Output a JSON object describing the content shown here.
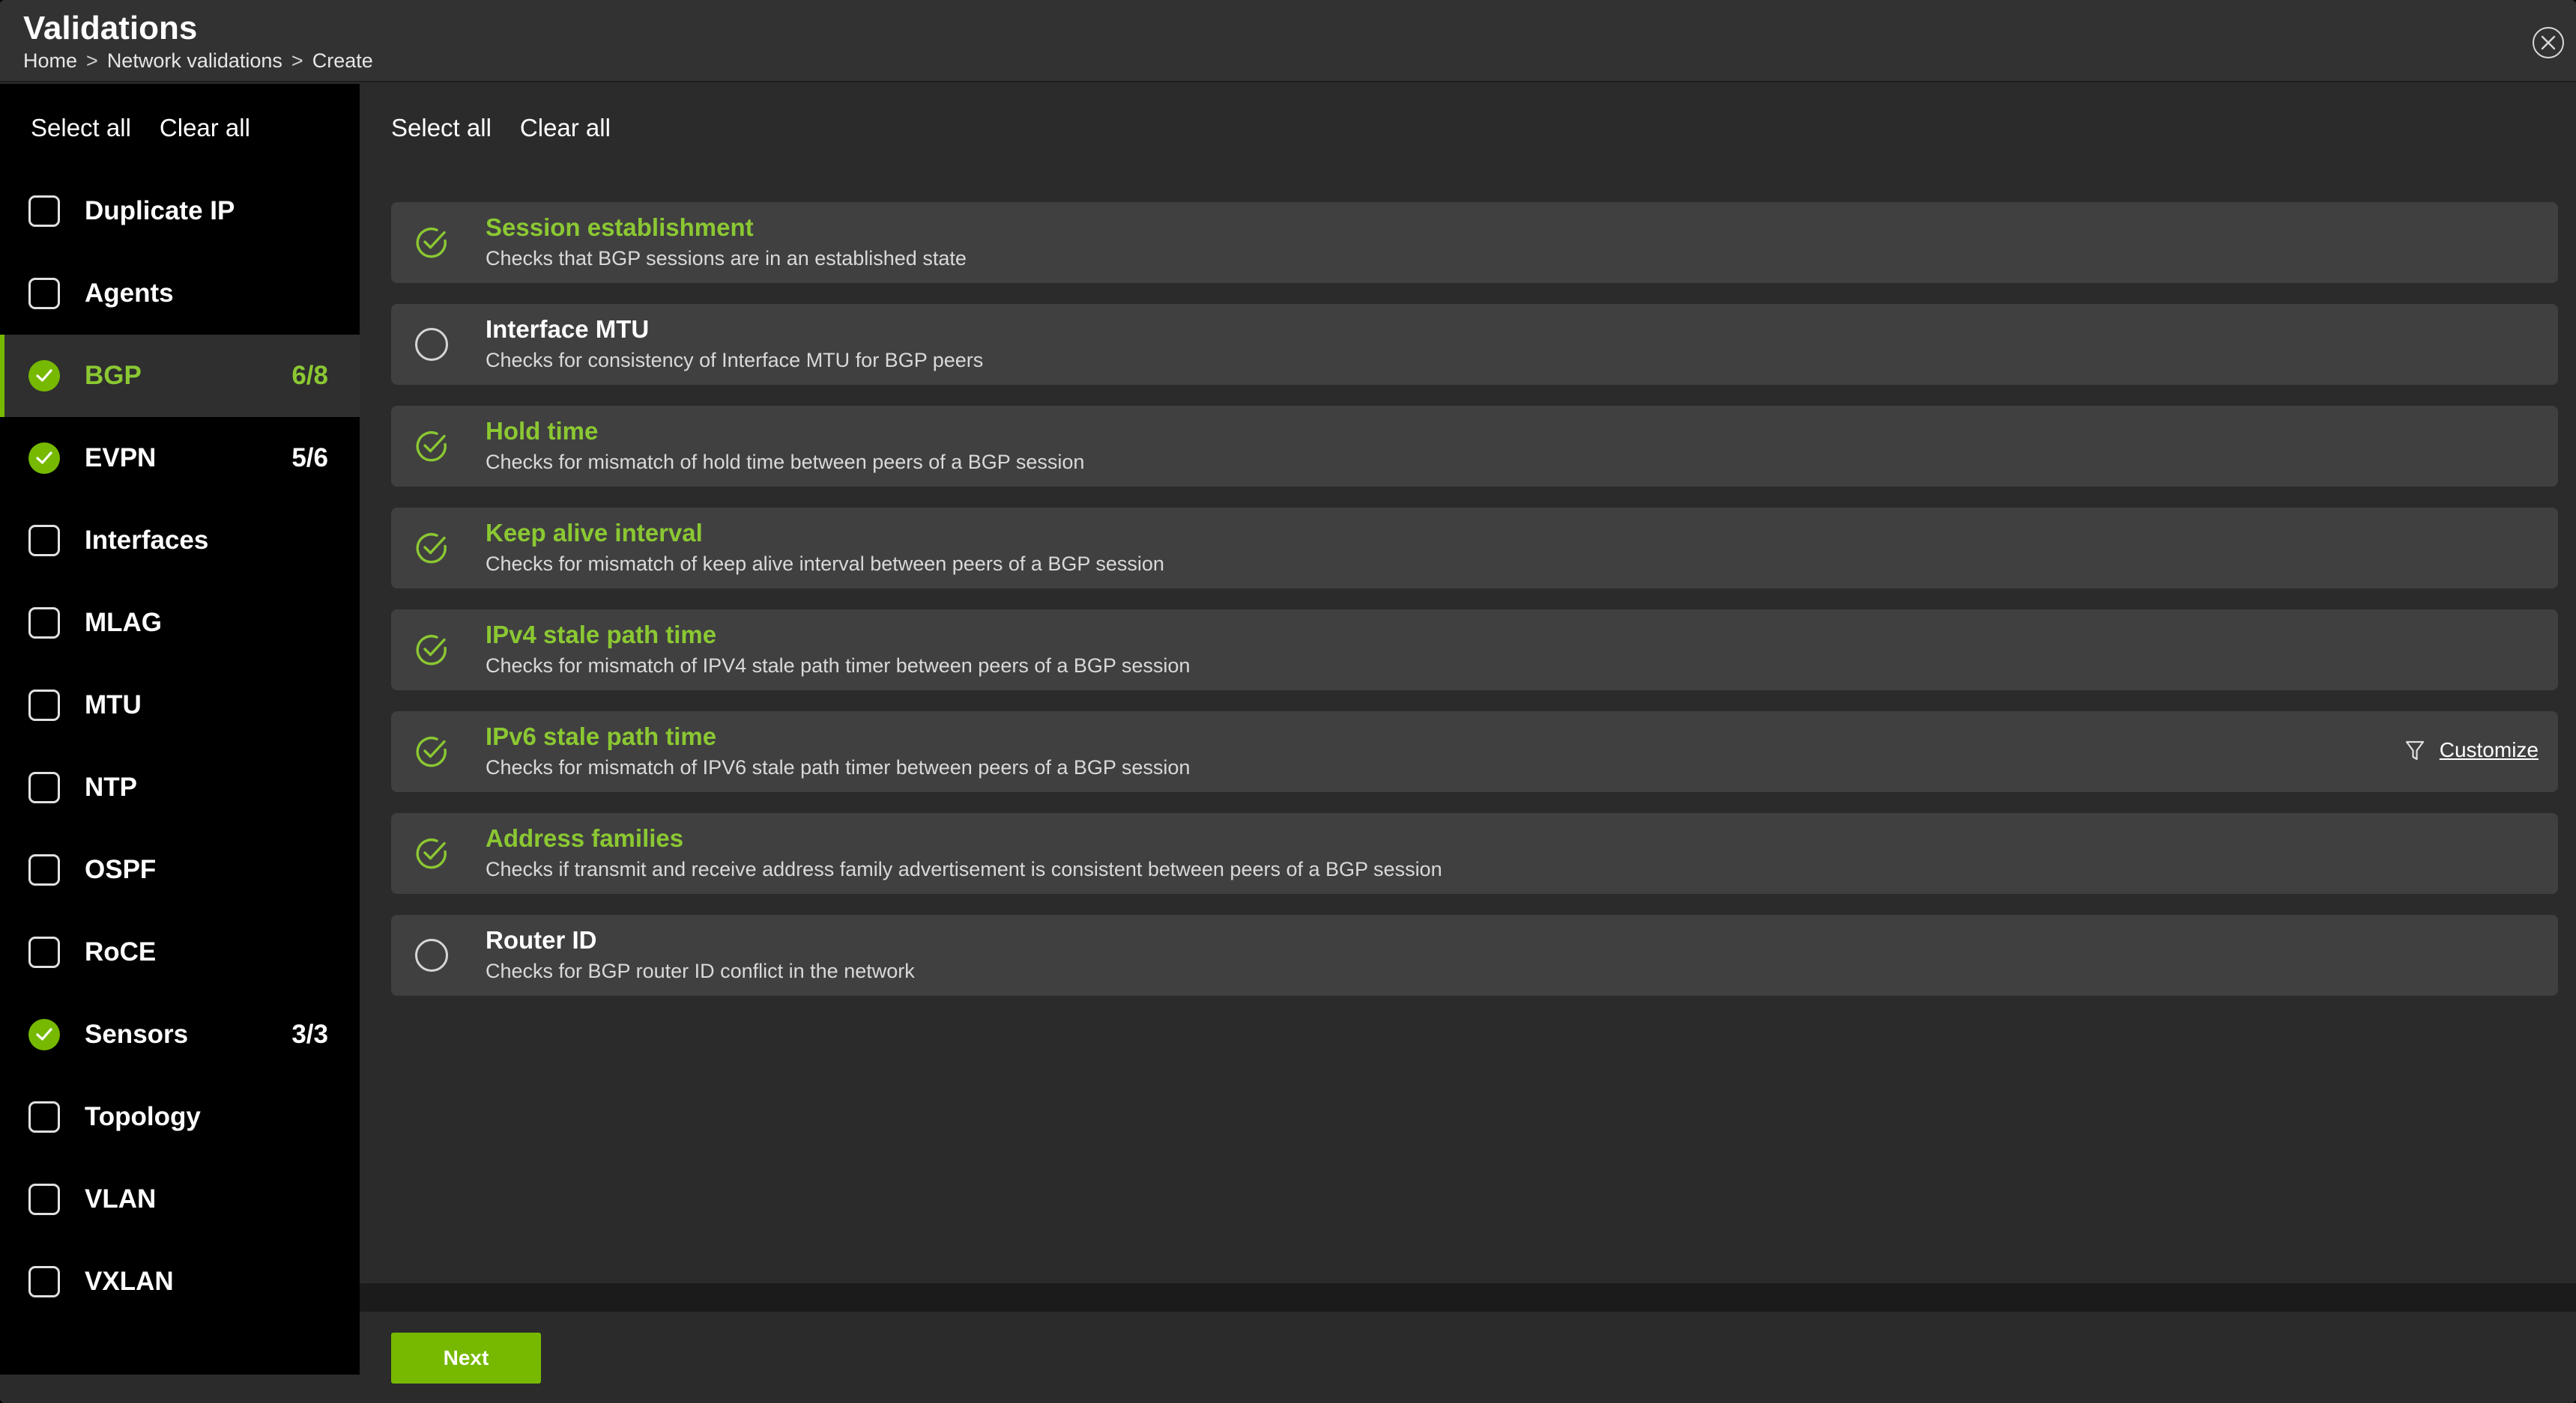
{
  "header": {
    "title": "Validations",
    "breadcrumb": [
      "Home",
      "Network validations",
      "Create"
    ],
    "separator": ">"
  },
  "sidebar": {
    "select_all": "Select all",
    "clear_all": "Clear all",
    "items": [
      {
        "label": "Duplicate IP",
        "checked": false,
        "count": ""
      },
      {
        "label": "Agents",
        "checked": false,
        "count": ""
      },
      {
        "label": "BGP",
        "checked": true,
        "count": "6/8",
        "active": true
      },
      {
        "label": "EVPN",
        "checked": true,
        "count": "5/6"
      },
      {
        "label": "Interfaces",
        "checked": false,
        "count": ""
      },
      {
        "label": "MLAG",
        "checked": false,
        "count": ""
      },
      {
        "label": "MTU",
        "checked": false,
        "count": ""
      },
      {
        "label": "NTP",
        "checked": false,
        "count": ""
      },
      {
        "label": "OSPF",
        "checked": false,
        "count": ""
      },
      {
        "label": "RoCE",
        "checked": false,
        "count": ""
      },
      {
        "label": "Sensors",
        "checked": true,
        "count": "3/3"
      },
      {
        "label": "Topology",
        "checked": false,
        "count": ""
      },
      {
        "label": "VLAN",
        "checked": false,
        "count": ""
      },
      {
        "label": "VXLAN",
        "checked": false,
        "count": ""
      }
    ]
  },
  "main": {
    "select_all": "Select all",
    "clear_all": "Clear all",
    "validations": [
      {
        "title": "Session establishment",
        "description": "Checks that BGP sessions are in an established state",
        "selected": true
      },
      {
        "title": "Interface MTU",
        "description": "Checks for consistency of Interface MTU for BGP peers",
        "selected": false
      },
      {
        "title": "Hold time",
        "description": "Checks for mismatch of hold time between peers of a BGP session",
        "selected": true
      },
      {
        "title": "Keep alive interval",
        "description": "Checks for mismatch of keep alive interval between peers of a BGP session",
        "selected": true
      },
      {
        "title": "IPv4 stale path time",
        "description": "Checks for mismatch of IPV4 stale path timer between peers of a BGP session",
        "selected": true
      },
      {
        "title": "IPv6 stale path time",
        "description": "Checks for mismatch of IPV6 stale path timer between peers of a BGP session",
        "selected": true,
        "action": "Customize"
      },
      {
        "title": "Address families",
        "description": "Checks if transmit and receive address family advertisement is consistent between peers of a BGP session",
        "selected": true
      },
      {
        "title": "Router ID",
        "description": "Checks for BGP router ID conflict in the network",
        "selected": false
      }
    ]
  },
  "footer": {
    "next_label": "Next"
  },
  "colors": {
    "accent": "#76b900",
    "accent_text": "#8bc832",
    "row_bg": "#404040",
    "sidebar_bg": "#000000"
  }
}
